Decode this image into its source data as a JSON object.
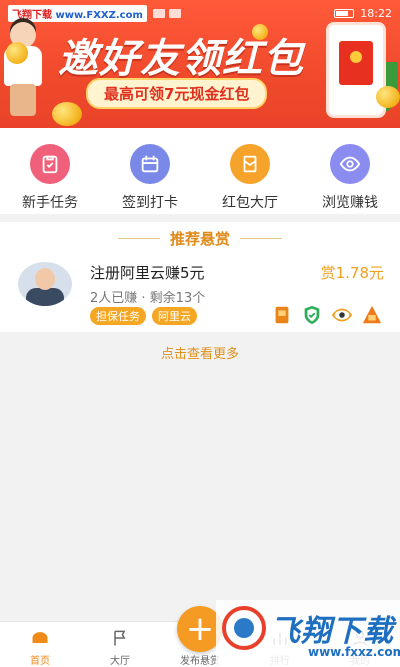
{
  "status_bar": {
    "watermark_tag_a": "飞翔下载",
    "watermark_tag_b": "www.FXXZ.com",
    "time": "18:22"
  },
  "banner": {
    "title": "邀好友领红包",
    "subtitle": "最高可领7元现金红包"
  },
  "quick_nav": [
    {
      "label": "新手任务",
      "icon": "clipboard-check-icon",
      "color": "#f0607a"
    },
    {
      "label": "签到打卡",
      "icon": "calendar-icon",
      "color": "#7a88e8"
    },
    {
      "label": "红包大厅",
      "icon": "red-packet-icon",
      "color": "#f5a32a"
    },
    {
      "label": "浏览赚钱",
      "icon": "eye-icon",
      "color": "#8a8cf0"
    }
  ],
  "recommend": {
    "title": "推荐悬赏",
    "task": {
      "title": "注册阿里云赚5元",
      "reward": "赏1.78元",
      "meta": "2人已赚 · 剩余13个",
      "tags": [
        "担保任务",
        "阿里云"
      ],
      "badges": [
        "cup-badge-icon",
        "shield-badge-icon",
        "eye-badge-icon",
        "top-badge-icon"
      ]
    },
    "more_label": "点击查看更多"
  },
  "tabbar": {
    "home": "首页",
    "hall": "大厅",
    "publish": "发布悬赏",
    "rank": "排行",
    "mine": "我的",
    "publish_symbol": "+"
  },
  "watermark": {
    "brand": "飞翔下载",
    "url": "www.fxxz.com"
  },
  "colors": {
    "accent": "#f59a23",
    "banner_red": "#f04a2c",
    "reward": "#f0a020"
  }
}
